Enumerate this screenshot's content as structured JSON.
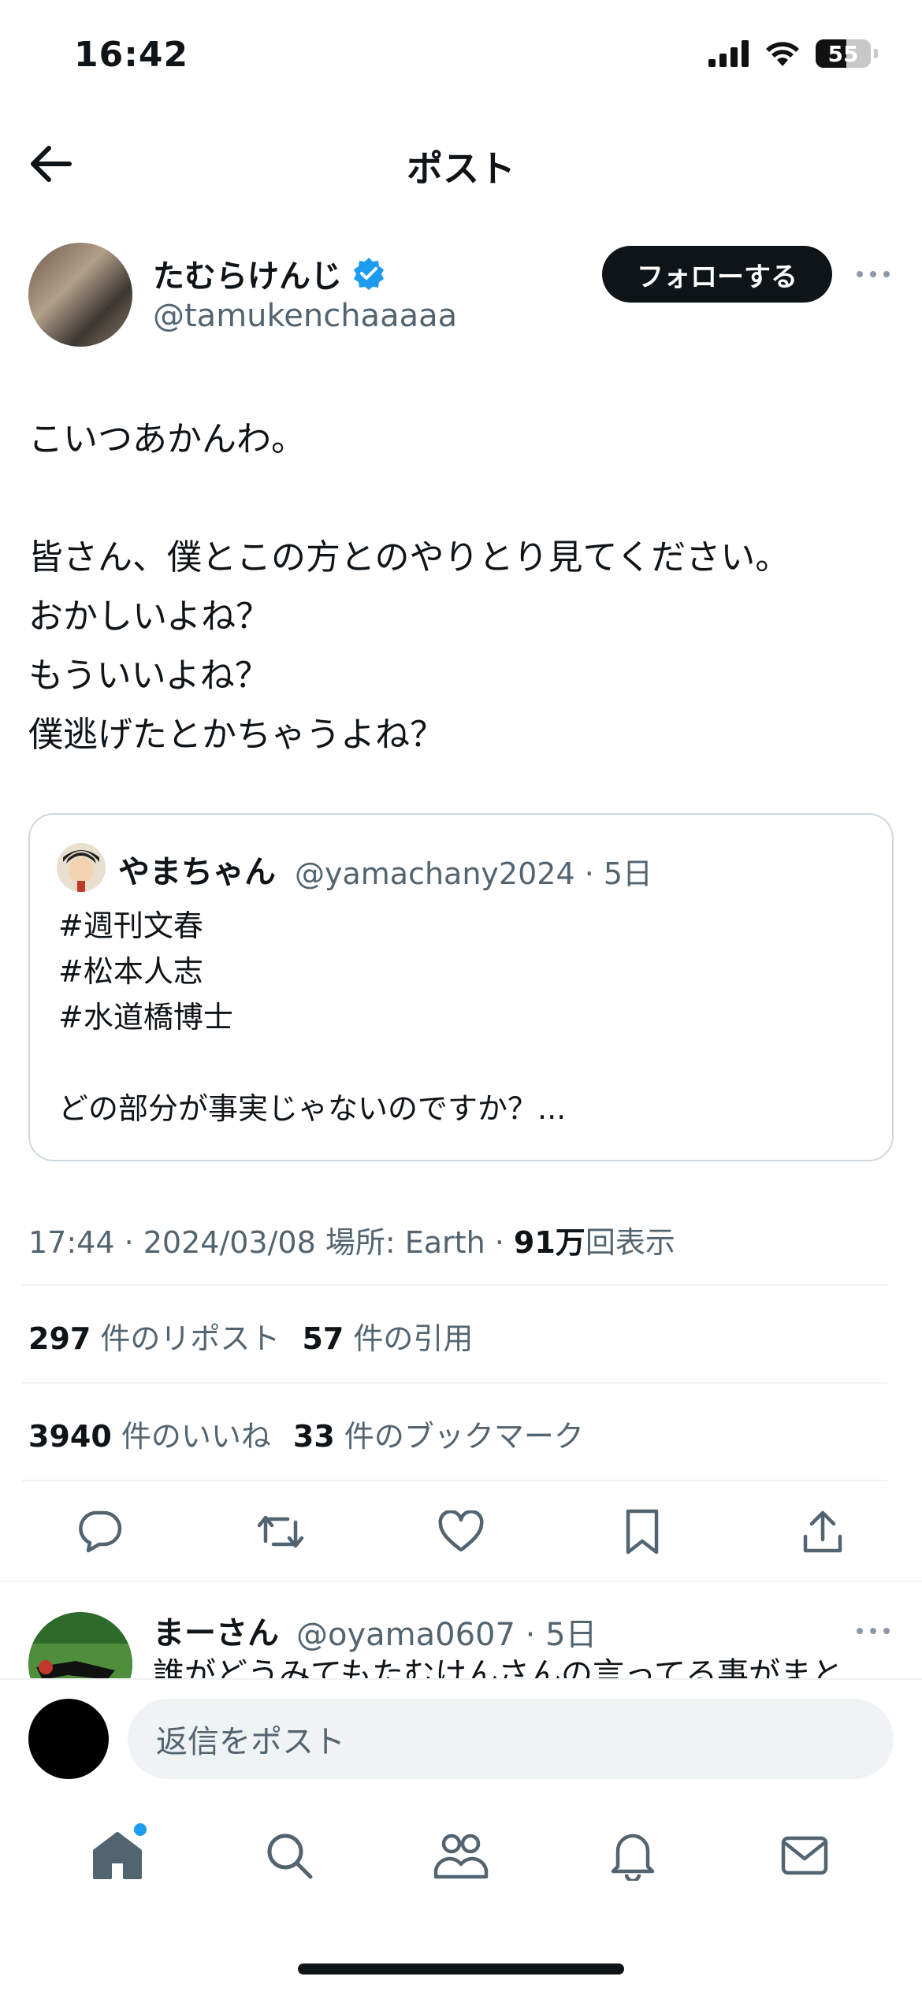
{
  "status_bar": {
    "time": "16:42",
    "battery": "55"
  },
  "header": {
    "title": "ポスト"
  },
  "author": {
    "name": "たむらけんじ",
    "handle": "@tamukenchaaaaa",
    "follow_label": "フォローする"
  },
  "post": {
    "text": "こいつあかんわ。\n\n皆さん、僕とこの方とのやりとり見てください。\nおかしいよね？\nもういいよね？\n僕逃げたとかちゃうよね？"
  },
  "quote": {
    "name": "やまちゃん",
    "handle_time": "@yamachany2024 · 5日",
    "text": "#週刊文春\n#松本人志\n#水道橋博士\n\nどの部分が事実じゃないのですか？..."
  },
  "meta": {
    "datetime": "17:44 · 2024/03/08",
    "location": "場所: Earth ·",
    "views_count": "91万",
    "views_label": "回表示"
  },
  "stats": {
    "reposts_count": "297",
    "reposts_label": "件のリポスト",
    "quotes_count": "57",
    "quotes_label": "件の引用",
    "likes_count": "3940",
    "likes_label": "件のいいね",
    "bookmarks_count": "33",
    "bookmarks_label": "件のブックマーク"
  },
  "reply": {
    "name": "まーさん",
    "handle_time": "@oyama0607 · 5日",
    "text": "誰がどうみてもたむけんさんの言ってる事がまと"
  },
  "composer": {
    "placeholder": "返信をポスト"
  },
  "colors": {
    "accent": "#1d9bf0",
    "text": "#0f1419",
    "secondary": "#536471",
    "border": "#eff3f4"
  },
  "icons": [
    "back-arrow-icon",
    "verified-badge-icon",
    "more-icon",
    "reply-icon",
    "repost-icon",
    "like-icon",
    "bookmark-icon",
    "share-icon",
    "home-icon",
    "search-icon",
    "communities-icon",
    "notifications-icon",
    "messages-icon"
  ]
}
